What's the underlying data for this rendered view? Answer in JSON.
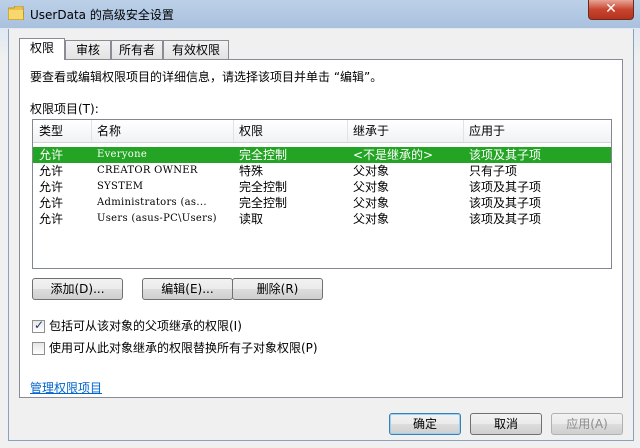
{
  "window": {
    "title": "UserData 的高级安全设置",
    "close_glyph": "✕"
  },
  "tabs": [
    {
      "label": "权限"
    },
    {
      "label": "审核"
    },
    {
      "label": "所有者"
    },
    {
      "label": "有效权限"
    }
  ],
  "description": "要查看或编辑权限项目的详细信息，请选择该项目并单击 “编辑”。",
  "list_label": "权限项目(T):",
  "columns": [
    "类型",
    "名称",
    "权限",
    "继承于",
    "应用于"
  ],
  "rows": [
    {
      "type": "允许",
      "name": "Everyone",
      "permission": "完全控制",
      "inherited": "<不是继承的>",
      "applies": "该项及其子项",
      "selected": true
    },
    {
      "type": "允许",
      "name": "CREATOR OWNER",
      "permission": "特殊",
      "inherited": "父对象",
      "applies": "只有子项",
      "selected": false
    },
    {
      "type": "允许",
      "name": "SYSTEM",
      "permission": "完全控制",
      "inherited": "父对象",
      "applies": "该项及其子项",
      "selected": false
    },
    {
      "type": "允许",
      "name": "Administrators (as...",
      "permission": "完全控制",
      "inherited": "父对象",
      "applies": "该项及其子项",
      "selected": false
    },
    {
      "type": "允许",
      "name": "Users (asus-PC\\Users)",
      "permission": "读取",
      "inherited": "父对象",
      "applies": "该项及其子项",
      "selected": false
    }
  ],
  "buttons": {
    "add": "添加(D)...",
    "edit": "编辑(E)...",
    "delete": "删除(R)",
    "ok": "确定",
    "cancel": "取消",
    "apply": "应用(A)"
  },
  "checkboxes": [
    {
      "label": "包括可从该对象的父项继承的权限(I)",
      "checked": true,
      "mark": "✓"
    },
    {
      "label": "使用可从此对象继承的权限替换所有子对象权限(P)",
      "checked": false,
      "mark": ""
    }
  ],
  "manage_link": "管理权限项目",
  "colors": {
    "selection": "#24a424",
    "link": "#0066cc",
    "close_button": "#c8452f"
  }
}
